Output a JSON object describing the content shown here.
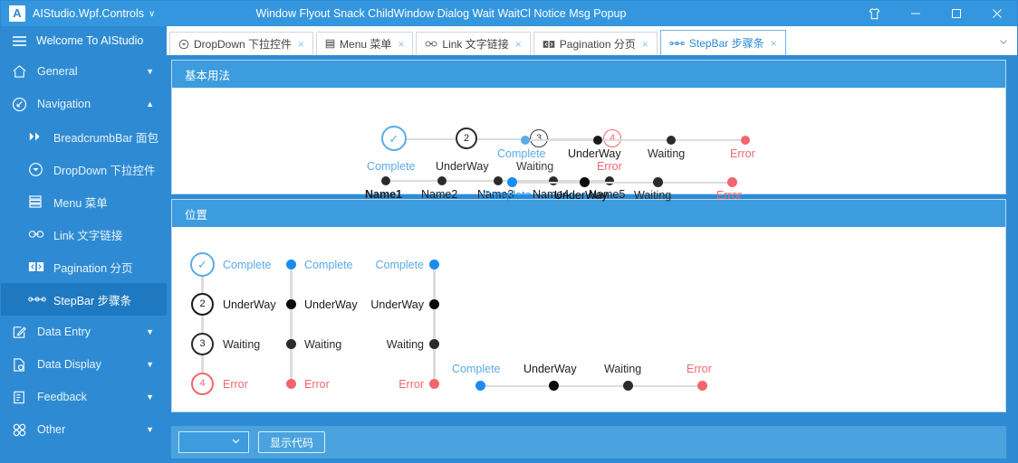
{
  "titlebar": {
    "logo_letter": "A",
    "app_name": "AIStudio.Wpf.Controls",
    "caret": "∨",
    "window_title": "Window Flyout Snack ChildWindow Dialog Wait WaitCl Notice Msg Popup",
    "theme_icon": "tshirt-icon",
    "minimize": "minimize-icon",
    "maximize": "maximize-icon",
    "close": "close-icon"
  },
  "sidebar": {
    "header": {
      "icon": "hamburger-icon",
      "label": "Welcome To AIStudio"
    },
    "items": [
      {
        "label": "General",
        "icon": "home-icon",
        "caret": "▼",
        "sub": false,
        "active": false
      },
      {
        "label": "Navigation",
        "icon": "navigate-icon",
        "caret": "▲",
        "sub": false,
        "active": false
      },
      {
        "label": "BreadcrumbBar 面包",
        "icon": "chevrons-icon",
        "caret": "",
        "sub": true,
        "active": false
      },
      {
        "label": "DropDown 下拉控件",
        "icon": "dropdown-icon",
        "caret": "",
        "sub": true,
        "active": false
      },
      {
        "label": "Menu 菜单",
        "icon": "menu-icon",
        "caret": "",
        "sub": true,
        "active": false
      },
      {
        "label": "Link 文字链接",
        "icon": "link-icon",
        "caret": "",
        "sub": true,
        "active": false
      },
      {
        "label": "Pagination 分页",
        "icon": "pagination-icon",
        "caret": "",
        "sub": true,
        "active": false
      },
      {
        "label": "StepBar 步骤条",
        "icon": "stepbar-icon",
        "caret": "",
        "sub": true,
        "active": true
      },
      {
        "label": "Data Entry",
        "icon": "edit-icon",
        "caret": "▼",
        "sub": false,
        "active": false
      },
      {
        "label": "Data Display",
        "icon": "document-search-icon",
        "caret": "▼",
        "sub": false,
        "active": false
      },
      {
        "label": "Feedback",
        "icon": "feedback-icon",
        "caret": "▼",
        "sub": false,
        "active": false
      },
      {
        "label": "Other",
        "icon": "grid-icon",
        "caret": "▼",
        "sub": false,
        "active": false
      }
    ]
  },
  "tabs": {
    "items": [
      {
        "label": "DropDown 下拉控件",
        "icon": "dropdown-icon",
        "close": "×",
        "active": false
      },
      {
        "label": "Menu 菜单",
        "icon": "menu-icon",
        "close": "×",
        "active": false
      },
      {
        "label": "Link 文字链接",
        "icon": "link-icon",
        "close": "×",
        "active": false
      },
      {
        "label": "Pagination 分页",
        "icon": "pagination-icon",
        "close": "×",
        "active": false
      },
      {
        "label": "StepBar 步骤条",
        "icon": "stepbar-icon",
        "close": "×",
        "active": true
      }
    ],
    "overflow_icon": "chevron-down-icon"
  },
  "colors": {
    "accent": "#2e8bd3",
    "header": "#3c9cdd",
    "complete_light": "#5aabe6",
    "complete_strong": "#1a8cf0",
    "pending": "#2b2b2b",
    "error": "#f4666e",
    "line": "#dcdcdc"
  },
  "sections": [
    {
      "title": "基本用法"
    },
    {
      "title": "位置"
    }
  ],
  "steps": {
    "status_labels": {
      "complete": "Complete",
      "underway": "UnderWay",
      "waiting": "Waiting",
      "error": "Error"
    },
    "numbers": {
      "two": "2",
      "three": "3",
      "four": "4"
    },
    "check": "✓",
    "names": [
      "Name1",
      "Name2",
      "Name3",
      "Name4",
      "Name5"
    ],
    "basic": {
      "circle_bar": {
        "orientation": "horizontal",
        "label_position": "below",
        "steps": [
          {
            "label": "Complete",
            "glyph": "✓",
            "state": "complete"
          },
          {
            "label": "UnderWay",
            "glyph": "2",
            "state": "underway"
          },
          {
            "label": "Waiting",
            "glyph": "3",
            "state": "waiting"
          },
          {
            "label": "Error",
            "glyph": "4",
            "state": "error"
          }
        ]
      },
      "name_bar": {
        "orientation": "horizontal",
        "label_position": "below",
        "steps": [
          {
            "label": "Name1",
            "state": "dark"
          },
          {
            "label": "Name2",
            "state": "dark"
          },
          {
            "label": "Name3",
            "state": "dark"
          },
          {
            "label": "Name4",
            "state": "dark"
          },
          {
            "label": "Name5",
            "state": "dark"
          }
        ]
      },
      "dot_bar_light": {
        "orientation": "horizontal",
        "label_position": "below",
        "steps": [
          {
            "label": "Complete",
            "state": "complete_light"
          },
          {
            "label": "UnderWay",
            "state": "underway"
          },
          {
            "label": "Waiting",
            "state": "waiting"
          },
          {
            "label": "Error",
            "state": "error"
          }
        ]
      },
      "dot_bar_strong": {
        "orientation": "horizontal",
        "label_position": "below",
        "steps": [
          {
            "label": "Complete",
            "state": "complete_strong"
          },
          {
            "label": "UnderWay",
            "state": "underway"
          },
          {
            "label": "Waiting",
            "state": "waiting"
          },
          {
            "label": "Error",
            "state": "error"
          }
        ]
      }
    },
    "position": {
      "vertical_circles": {
        "orientation": "vertical",
        "label_position": "right",
        "steps": [
          {
            "label": "Complete",
            "glyph": "✓",
            "state": "complete"
          },
          {
            "label": "UnderWay",
            "glyph": "2",
            "state": "underway"
          },
          {
            "label": "Waiting",
            "glyph": "3",
            "state": "waiting"
          },
          {
            "label": "Error",
            "glyph": "4",
            "state": "error"
          }
        ]
      },
      "vertical_dots_right_label": {
        "orientation": "vertical",
        "label_position": "right",
        "steps": [
          {
            "label": "Complete",
            "state": "complete_light"
          },
          {
            "label": "UnderWay",
            "state": "underway"
          },
          {
            "label": "Waiting",
            "state": "waiting"
          },
          {
            "label": "Error",
            "state": "error"
          }
        ]
      },
      "vertical_dots_left_label": {
        "orientation": "vertical",
        "label_position": "left",
        "steps": [
          {
            "label": "Complete",
            "state": "complete_light"
          },
          {
            "label": "UnderWay",
            "state": "underway"
          },
          {
            "label": "Waiting",
            "state": "waiting"
          },
          {
            "label": "Error",
            "state": "error"
          }
        ]
      },
      "horizontal_label_above": {
        "orientation": "horizontal",
        "label_position": "above",
        "steps": [
          {
            "label": "Complete",
            "state": "complete_strong"
          },
          {
            "label": "UnderWay",
            "state": "underway"
          },
          {
            "label": "Waiting",
            "state": "waiting"
          },
          {
            "label": "Error",
            "state": "error"
          }
        ]
      }
    }
  },
  "bottombar": {
    "combo_value": "",
    "combo_caret": "∨",
    "show_code_label": "显示代码"
  }
}
